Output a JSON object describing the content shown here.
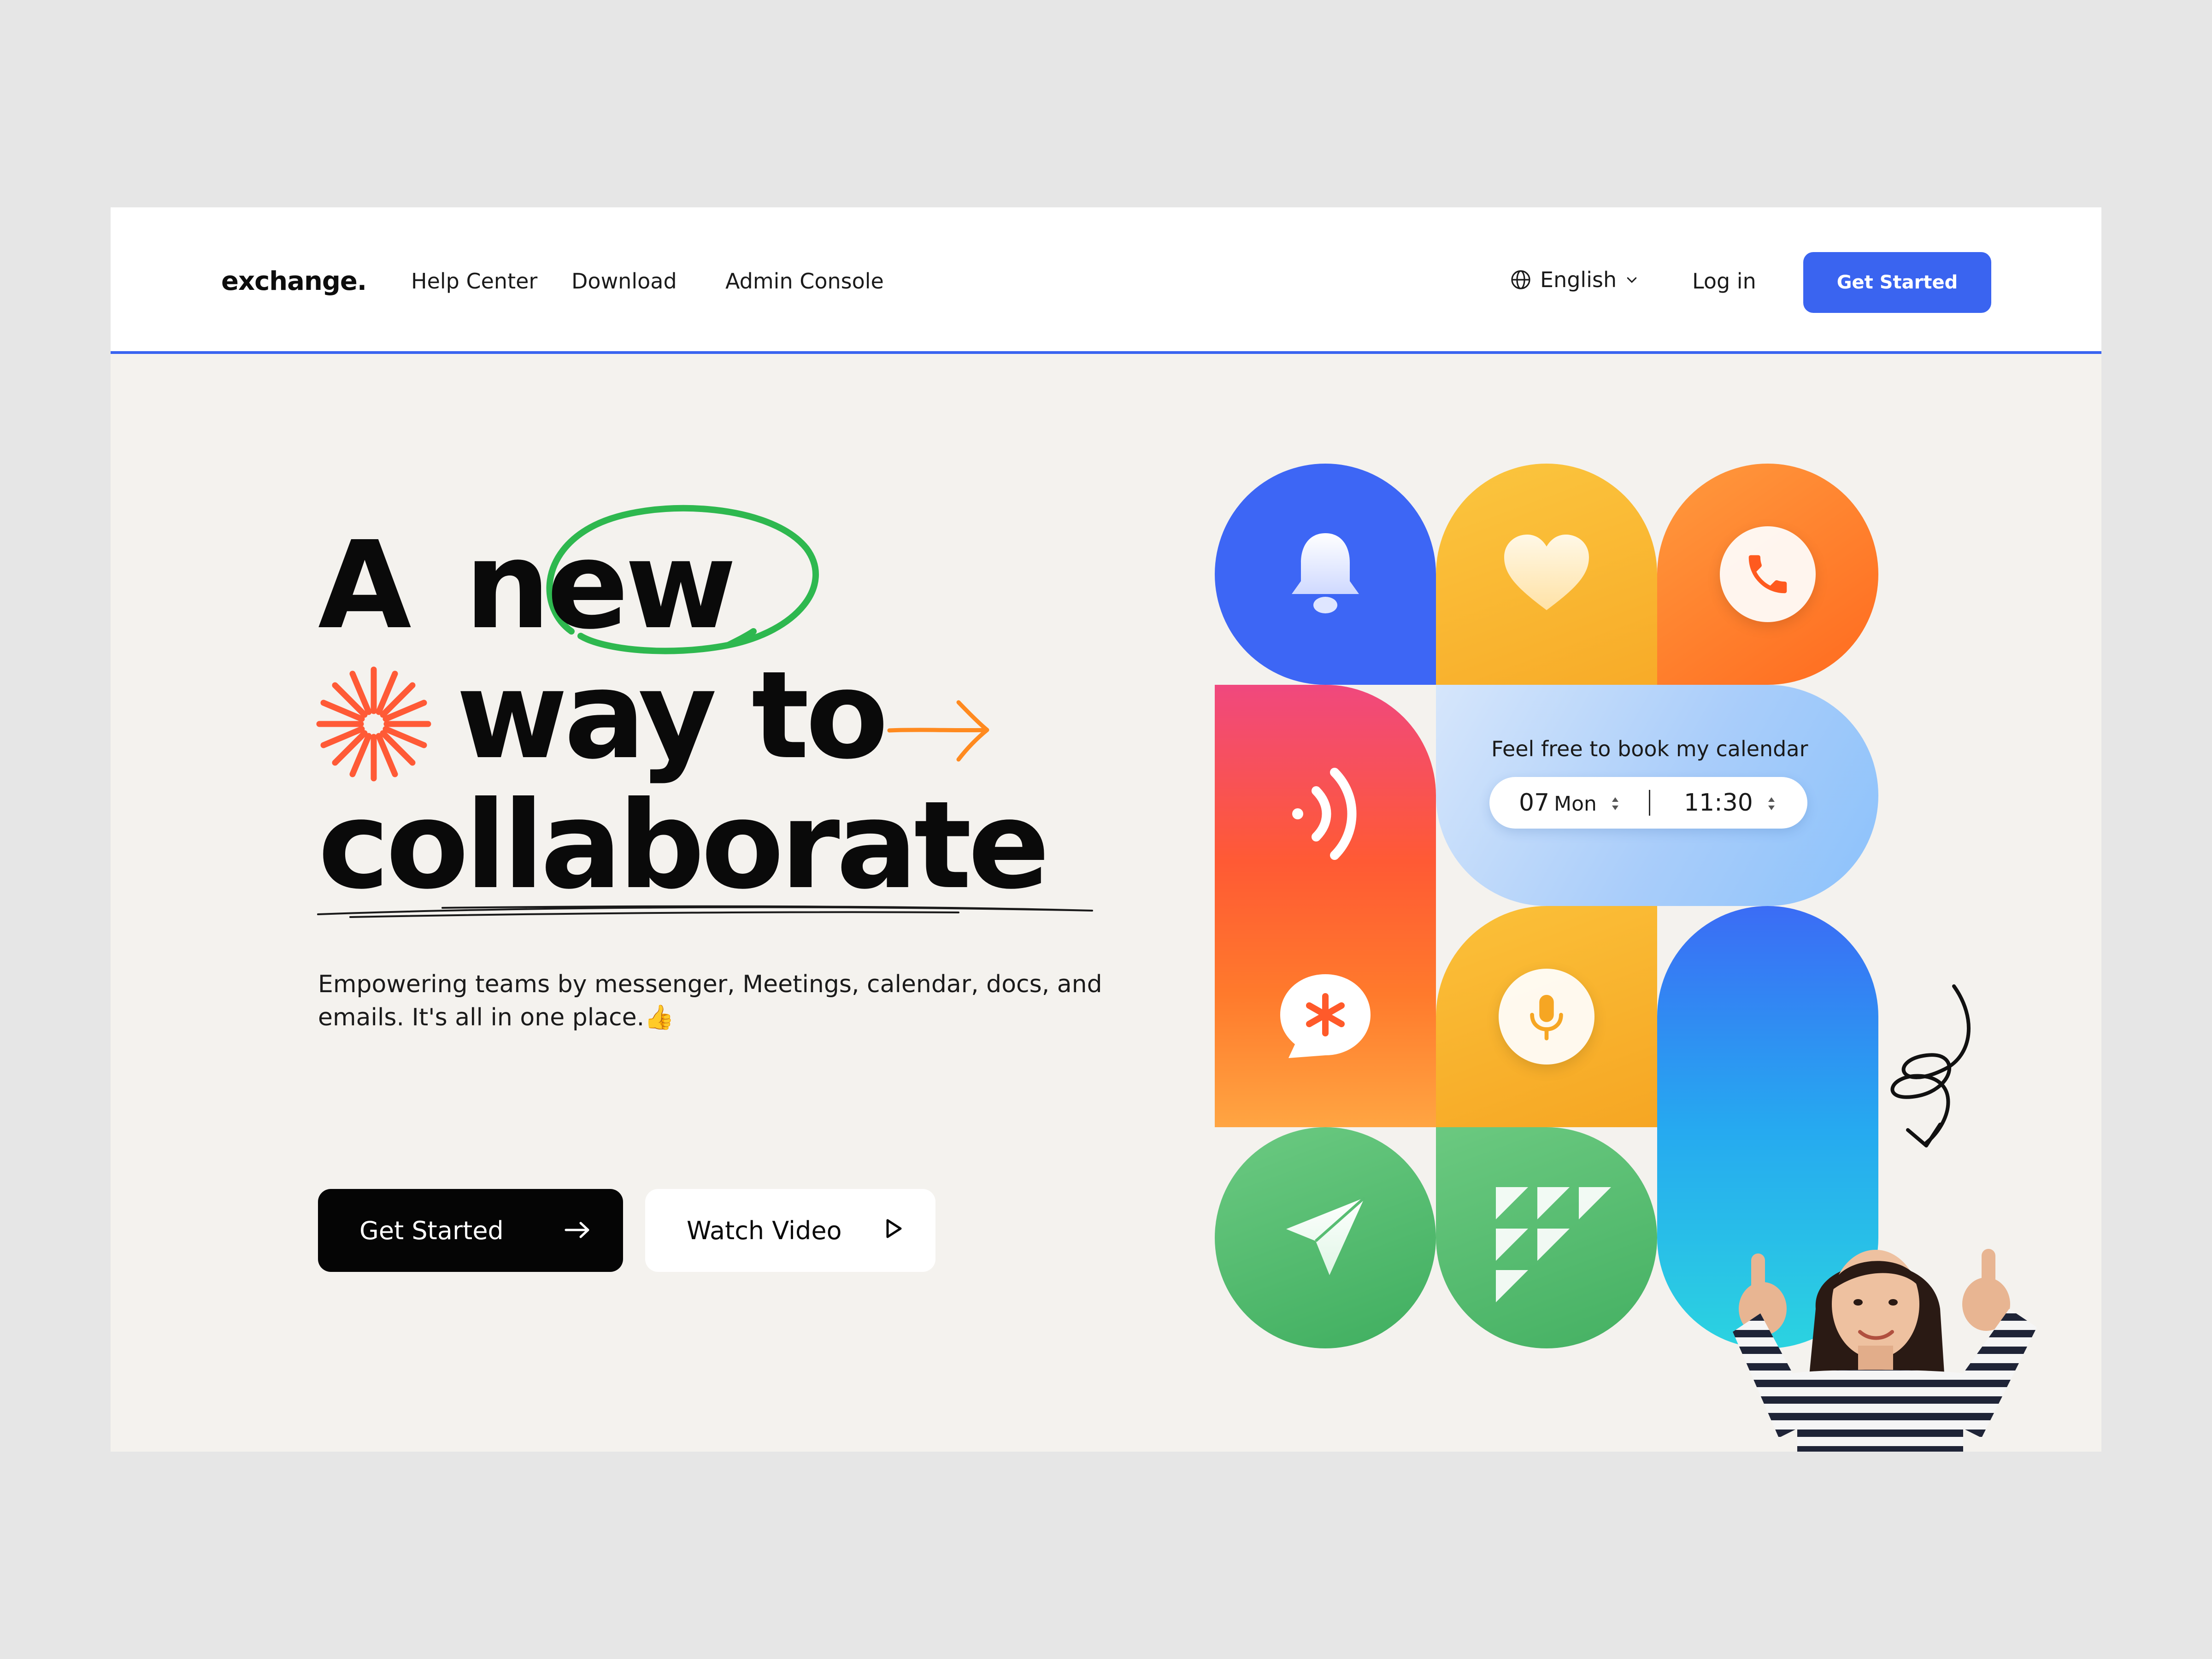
{
  "navbar": {
    "logo": "exchange.",
    "links": [
      "Help Center",
      "Download",
      "Admin Console"
    ],
    "language": "English",
    "login": "Log in",
    "cta": "Get Started"
  },
  "hero": {
    "headline_line1_a": "A",
    "headline_line1_b": "new",
    "headline_line2": "way to",
    "headline_line3": "collaborate",
    "subtitle": "Empowering teams by messenger, Meetings, calendar, docs, and emails. It's all in one place.👍",
    "primary_button": "Get Started",
    "secondary_button": "Watch Video"
  },
  "calendar_widget": {
    "label": "Feel free to book my calendar",
    "day_number": "07",
    "day_name": "Mon",
    "time": "11:30"
  },
  "icons": {
    "tiles": [
      "bell-icon",
      "heart-icon",
      "phone-icon",
      "signal-icon",
      "asterisk-chat-icon",
      "mic-icon",
      "send-icon",
      "triangles-icon"
    ],
    "decor": [
      "globe-icon",
      "chevron-down-icon",
      "arrow-right-icon",
      "play-icon",
      "circle-scribble",
      "sunburst",
      "arrow-scribble",
      "underline-scribble",
      "squiggle-arrow"
    ]
  },
  "colors": {
    "accent_blue": "#3a64f0",
    "headline_circle": "#2eb84f",
    "burst": "#ff5a36",
    "arrow_orange": "#ff8a1f",
    "tile_yellow": "#f8ab28",
    "tile_orange": "#ff6a1f",
    "tile_green": "#44b062"
  }
}
